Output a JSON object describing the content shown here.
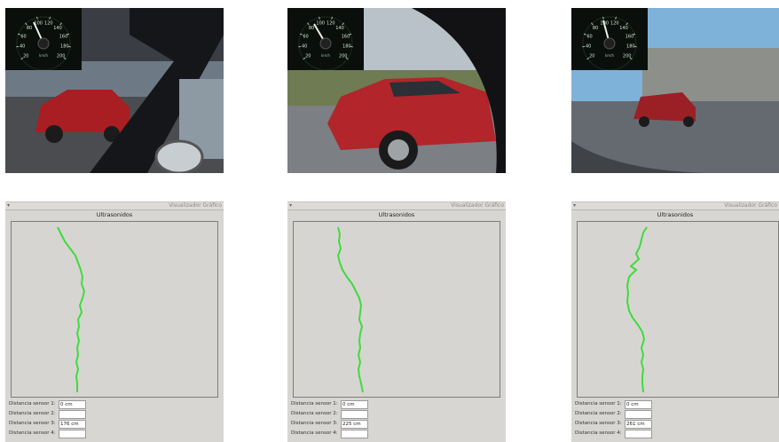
{
  "examples": [
    {
      "panel": {
        "window_title": "Visualizador Gráfico",
        "plot_title": "Ultrasonidos",
        "sensors": [
          {
            "label": "Distancia sensor 1:",
            "value": "0 cm"
          },
          {
            "label": "Distancia sensor 2:",
            "value": ""
          },
          {
            "label": "Distancia sensor 3:",
            "value": "176 cm"
          },
          {
            "label": "Distancia sensor 4:",
            "value": ""
          }
        ]
      }
    },
    {
      "panel": {
        "window_title": "Visualizador Gráfico",
        "plot_title": "Ultrasonidos",
        "sensors": [
          {
            "label": "Distancia sensor 1:",
            "value": "0 cm"
          },
          {
            "label": "Distancia sensor 2:",
            "value": ""
          },
          {
            "label": "Distancia sensor 3:",
            "value": "225 cm"
          },
          {
            "label": "Distancia sensor 4:",
            "value": ""
          }
        ]
      }
    },
    {
      "panel": {
        "window_title": "Visualizador Gráfico",
        "plot_title": "Ultrasonidos",
        "sensors": [
          {
            "label": "Distancia sensor 1:",
            "value": "0 cm"
          },
          {
            "label": "Distancia sensor 2:",
            "value": ""
          },
          {
            "label": "Distancia sensor 3:",
            "value": "261 cm"
          },
          {
            "label": "Distancia sensor 4:",
            "value": ""
          }
        ]
      }
    }
  ],
  "speedometer": {
    "ticks": [
      "20",
      "40",
      "60",
      "80",
      "100",
      "120",
      "140",
      "160",
      "180",
      "200"
    ],
    "unit": "km/h"
  },
  "colors": {
    "trace": "#3ddc3d",
    "panel_bg": "#d8d6d2",
    "plot_border": "#7c7c7c"
  }
}
